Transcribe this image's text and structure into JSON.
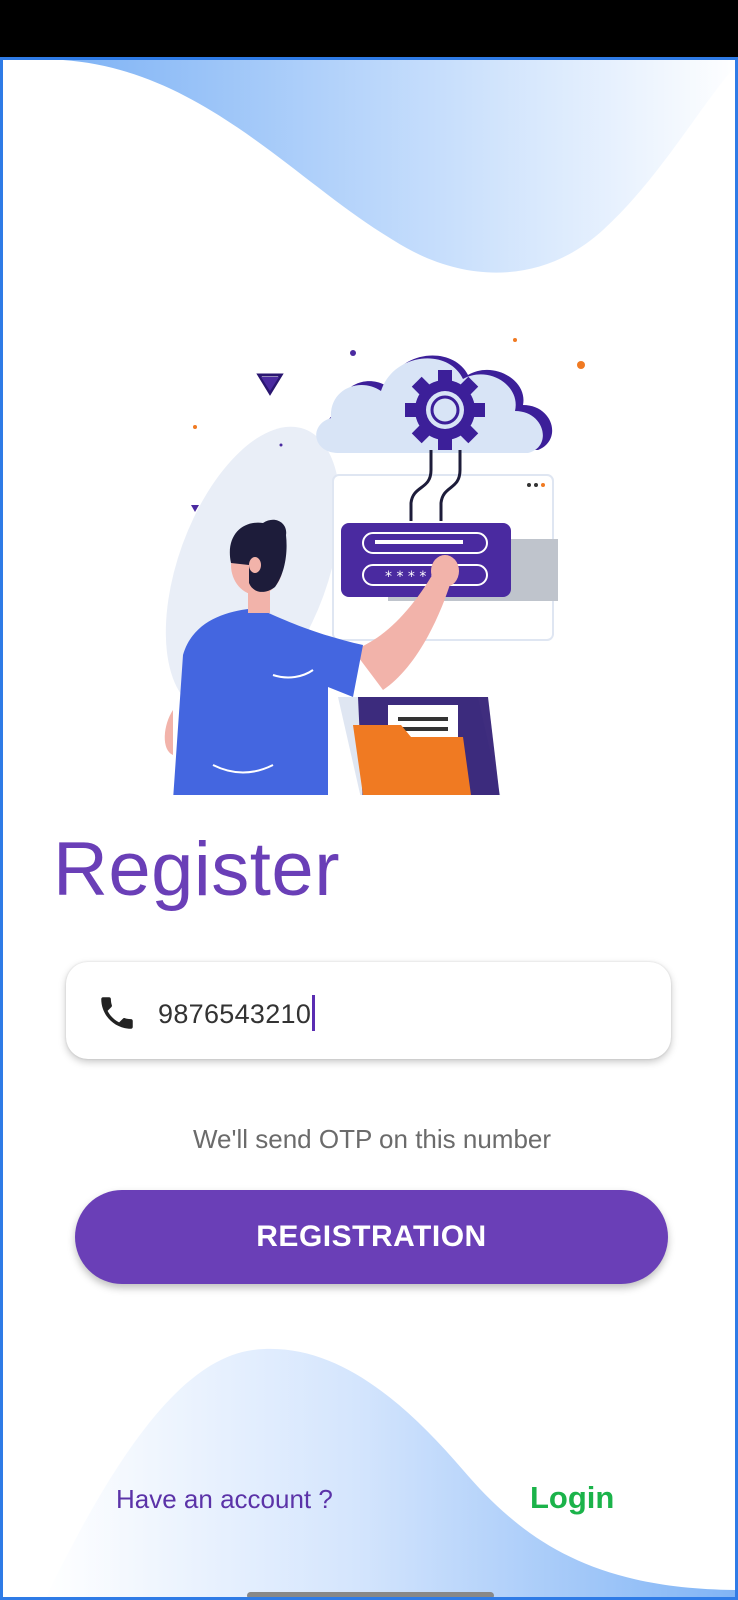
{
  "colors": {
    "accent": "#6a3fb7",
    "login": "#1bb34a",
    "wave": "#a9cdfb",
    "frame": "#2f7be6"
  },
  "register": {
    "title": "Register",
    "phone_icon": "phone-icon",
    "phone_value": "9876543210",
    "hint": "We'll send OTP on this number",
    "button_label": "REGISTRATION"
  },
  "footer": {
    "have_account": "Have an account ?",
    "login_label": "Login"
  }
}
